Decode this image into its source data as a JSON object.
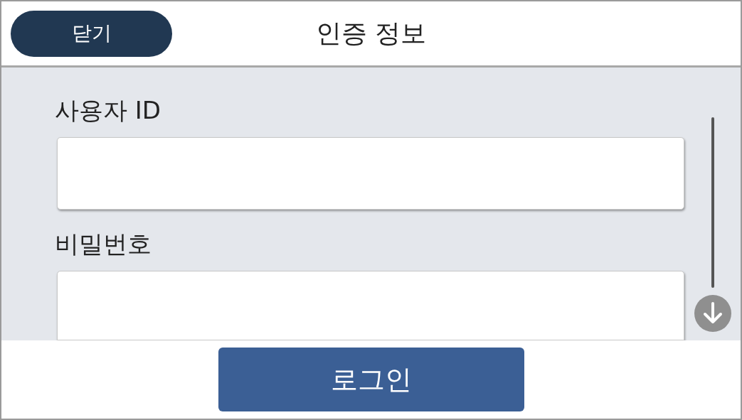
{
  "header": {
    "close_button": "닫기",
    "title": "인증 정보"
  },
  "fields": [
    {
      "label": "사용자 ID"
    },
    {
      "label": "비밀번호"
    }
  ],
  "login_button": "로그인"
}
